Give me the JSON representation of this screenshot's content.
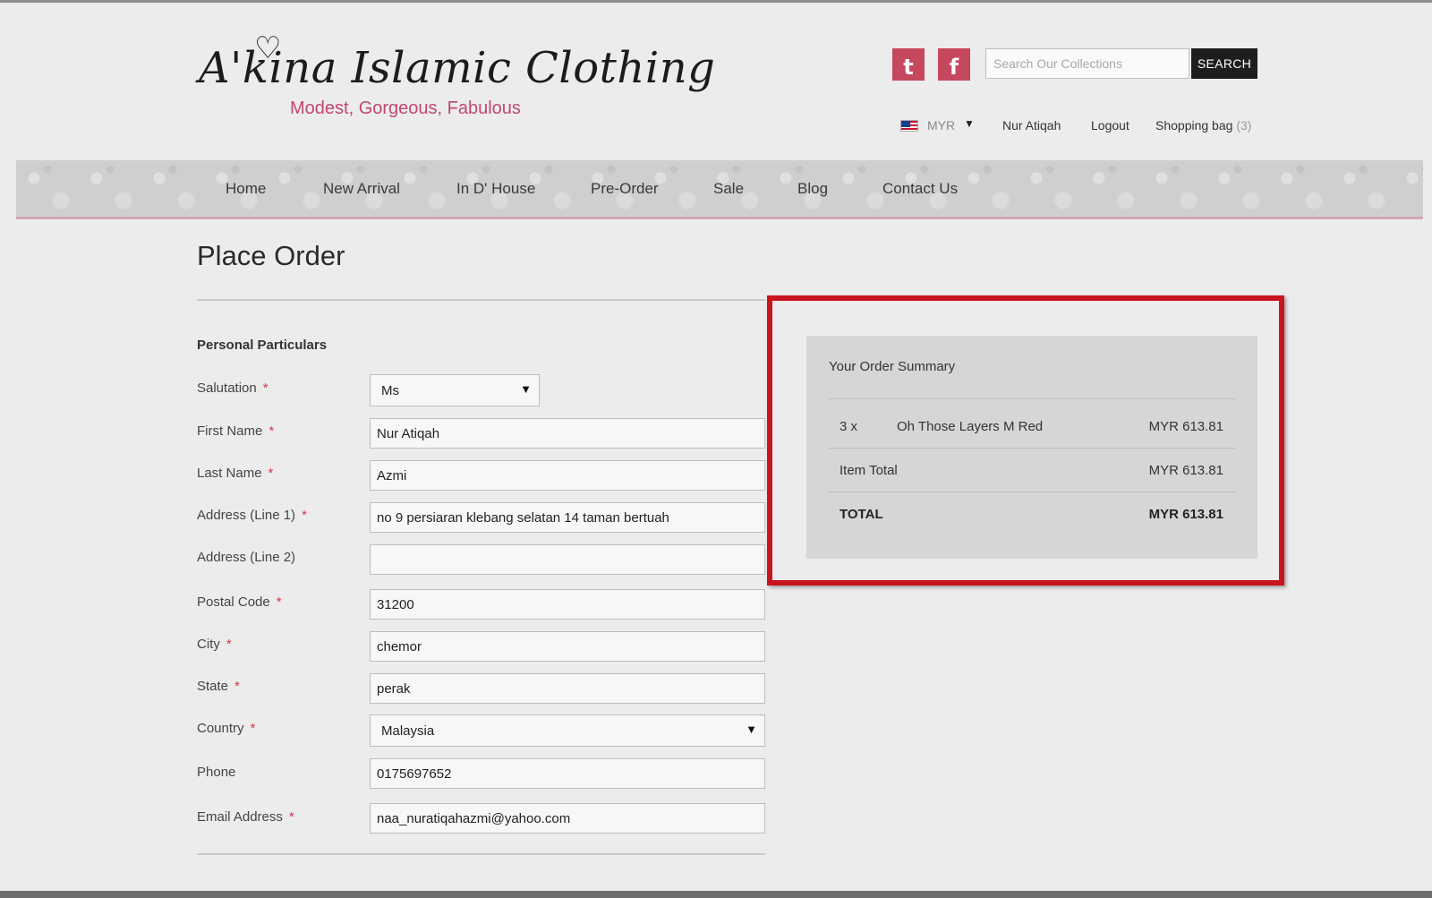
{
  "header": {
    "logo": {
      "brand": "A'kina Islamic Clothing",
      "tagline": "Modest, Gorgeous, Fabulous"
    },
    "social": [
      {
        "icon": "twitter-icon",
        "glyph": "t"
      },
      {
        "icon": "facebook-icon",
        "glyph": "f"
      }
    ],
    "search": {
      "placeholder": "Search Our Collections",
      "button_label": "SEARCH"
    },
    "account": {
      "currency": "MYR",
      "user_name": "Nur Atiqah",
      "logout_label": "Logout",
      "bag_label": "Shopping bag",
      "bag_count": "(3)"
    }
  },
  "nav": {
    "items": [
      "Home",
      "New Arrival",
      "In D' House",
      "Pre-Order",
      "Sale",
      "Blog",
      "Contact Us"
    ]
  },
  "page": {
    "title": "Place Order"
  },
  "form": {
    "section_title": "Personal Particulars",
    "required_marker": "*",
    "fields": {
      "salutation": {
        "label": "Salutation",
        "value": "Ms"
      },
      "first_name": {
        "label": "First Name",
        "value": "Nur Atiqah"
      },
      "last_name": {
        "label": "Last Name",
        "value": "Azmi"
      },
      "address1": {
        "label": "Address (Line 1)",
        "value": "no 9 persiaran klebang selatan 14 taman bertuah"
      },
      "address2": {
        "label": "Address (Line 2)",
        "value": ""
      },
      "postal_code": {
        "label": "Postal Code",
        "value": "31200"
      },
      "city": {
        "label": "City",
        "value": "chemor"
      },
      "state": {
        "label": "State",
        "value": "perak"
      },
      "country": {
        "label": "Country",
        "value": "Malaysia"
      },
      "phone": {
        "label": "Phone",
        "value": "0175697652"
      },
      "email": {
        "label": "Email Address",
        "value": "naa_nuratiqahazmi@yahoo.com"
      }
    }
  },
  "summary": {
    "title": "Your Order Summary",
    "item": {
      "qty": "3 x",
      "name": "Oh Those Layers M Red",
      "price": "MYR 613.81"
    },
    "item_total": {
      "label": "Item Total",
      "value": "MYR 613.81"
    },
    "total": {
      "label": "TOTAL",
      "value": "MYR 613.81"
    }
  },
  "colors": {
    "accent_pink": "#c1476f",
    "social_red": "#c6485e",
    "highlight_red": "#c9141f",
    "required_red": "#d23a4a"
  }
}
